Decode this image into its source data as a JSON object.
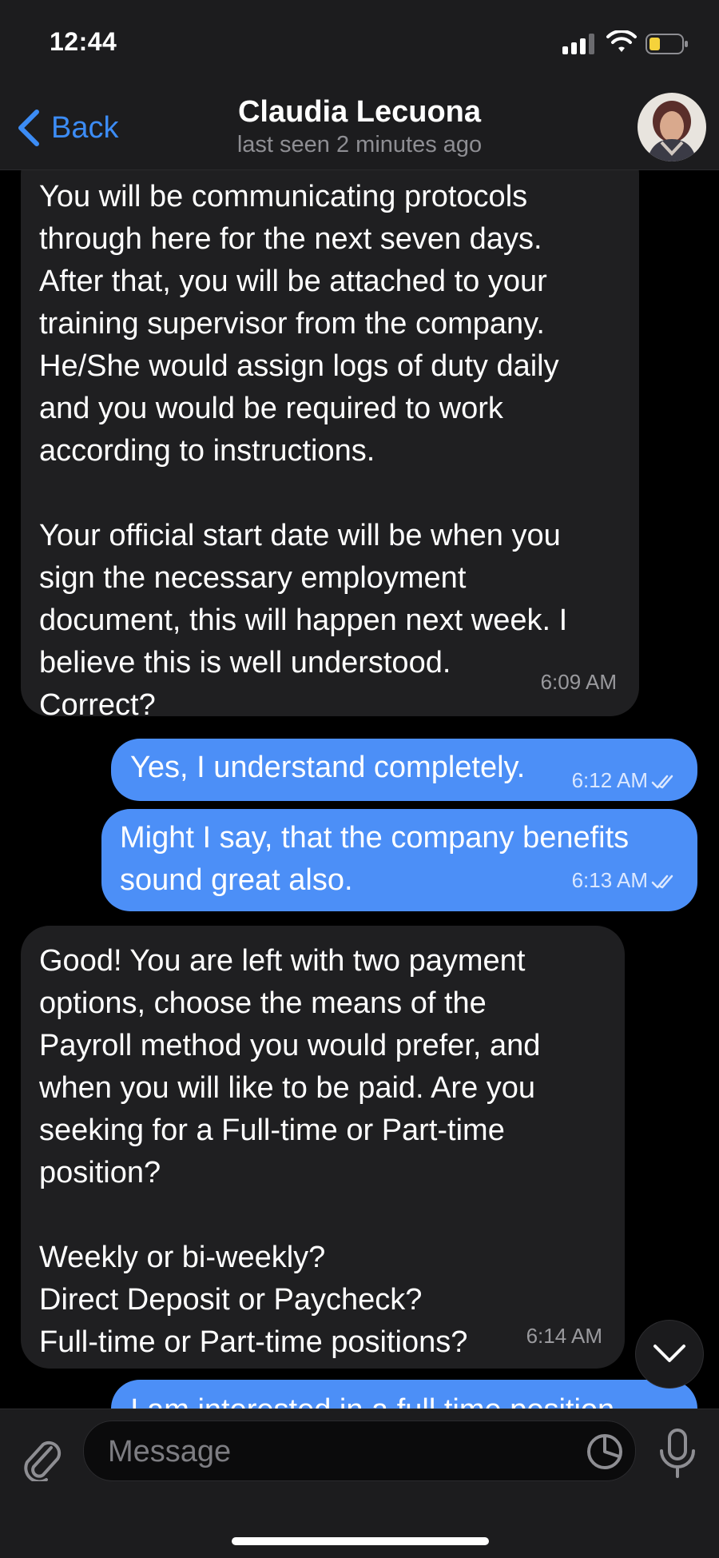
{
  "status_bar": {
    "time": "12:44"
  },
  "header": {
    "back_label": "Back",
    "contact_name": "Claudia Lecuona",
    "last_seen": "last seen 2 minutes ago"
  },
  "messages": [
    {
      "direction": "incoming",
      "text": "You will be communicating protocols\nthrough here for the next seven days.\nAfter that, you will be attached to your\ntraining supervisor from the company.\nHe/She would assign logs of duty daily\nand you would be required to work\naccording to instructions.\n\nYour official start date will be when you\nsign the necessary employment\ndocument, this will happen next week. I\nbelieve this is well understood.\nCorrect?",
      "time": "6:09 AM"
    },
    {
      "direction": "outgoing",
      "text": "Yes, I understand completely.",
      "time": "6:12 AM",
      "status": "read"
    },
    {
      "direction": "outgoing",
      "text": "Might I say, that the company benefits\nsound great also.",
      "time": "6:13 AM",
      "status": "read"
    },
    {
      "direction": "incoming",
      "text": "Good! You are left with two payment\noptions, choose the means of the\nPayroll method you would prefer, and\nwhen you will like to be paid. Are you\nseeking for a Full-time or Part-time\nposition?\n\nWeekly or bi-weekly?\nDirect Deposit or Paycheck?\nFull-time or Part-time positions?",
      "time": "6:14 AM"
    },
    {
      "direction": "outgoing",
      "text": "I am interested in a full time position",
      "time": ""
    }
  ],
  "input": {
    "placeholder": "Message"
  },
  "colors": {
    "accent": "#3c8cf5",
    "outgoing_bubble": "#4c8ff7",
    "incoming_bubble": "#1f1f21"
  },
  "icons": [
    "back-chevron-icon",
    "attach-icon",
    "sticker-icon",
    "microphone-icon",
    "chevron-down-icon",
    "read-checks-icon"
  ]
}
